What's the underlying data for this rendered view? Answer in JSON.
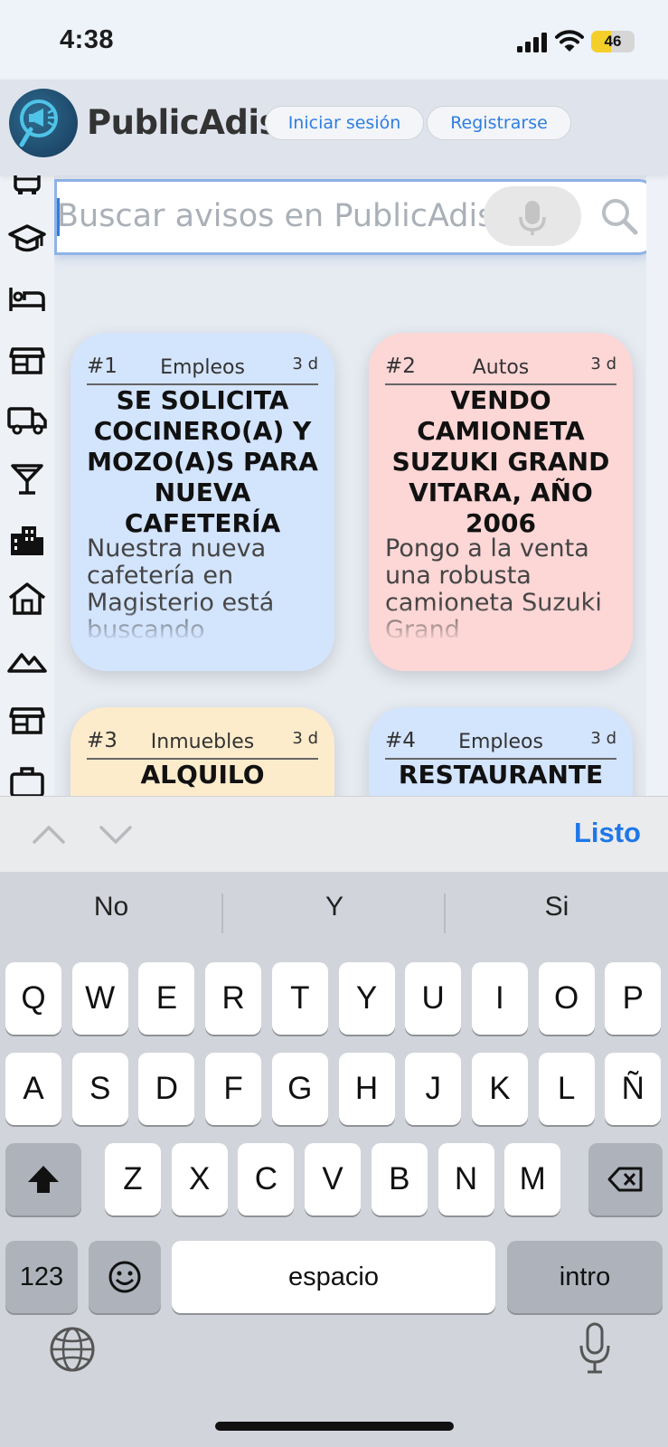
{
  "status_bar": {
    "time": "4:38",
    "battery": "46",
    "battery_level": 0.46
  },
  "header": {
    "brand": "PublicAdis",
    "login_label": "Iniciar sesión",
    "register_label": "Registrarse"
  },
  "search": {
    "placeholder": "Buscar avisos en PublicAdis"
  },
  "sidebar_icons": [
    "bus-icon",
    "graduation-cap-icon",
    "bed-icon",
    "store-icon",
    "truck-icon",
    "cocktail-icon",
    "building-icon",
    "house-icon",
    "mountains-icon",
    "shop-icon",
    "briefcase-icon"
  ],
  "cards": [
    {
      "number": "#1",
      "category": "Empleos",
      "age": "3 d",
      "title": "SE SOLICITA COCINERO(A) Y MOZO(A)S PARA NUEVA CAFETERÍA",
      "description": "Nuestra nueva cafetería en Magisterio está buscando",
      "color": "#d3e4fd"
    },
    {
      "number": "#2",
      "category": "Autos",
      "age": "3 d",
      "title": "VENDO CAMIONETA SUZUKI GRAND VITARA, AÑO 2006",
      "description": "Pongo a la venta una robusta camioneta Suzuki Grand",
      "color": "#fdd6d6"
    },
    {
      "number": "#3",
      "category": "Inmuebles",
      "age": "3 d",
      "title": "ALQUILO",
      "description": "",
      "color": "#fdeccc"
    },
    {
      "number": "#4",
      "category": "Empleos",
      "age": "3 d",
      "title": "RESTAURANTE",
      "description": "",
      "color": "#d3e4fd"
    }
  ],
  "keyboard": {
    "done_label": "Listo",
    "suggestions": [
      "No",
      "Y",
      "Si"
    ],
    "row1": [
      "Q",
      "W",
      "E",
      "R",
      "T",
      "Y",
      "U",
      "I",
      "O",
      "P"
    ],
    "row2": [
      "A",
      "S",
      "D",
      "F",
      "G",
      "H",
      "J",
      "K",
      "L",
      "Ñ"
    ],
    "row3": [
      "Z",
      "X",
      "C",
      "V",
      "B",
      "N",
      "M"
    ],
    "numbers_label": "123",
    "space_label": "espacio",
    "return_label": "intro"
  }
}
